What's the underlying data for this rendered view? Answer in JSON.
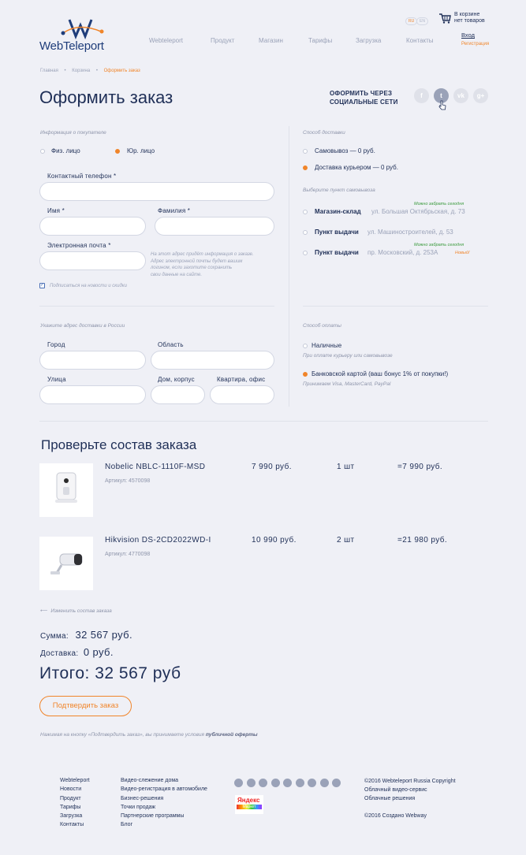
{
  "header": {
    "logo": "WebTeleport",
    "nav": [
      "Webteleport",
      "Продукт",
      "Магазин",
      "Тарифы",
      "Загрузка",
      "Контакты"
    ],
    "lang": [
      "RU",
      "EN"
    ],
    "cart_line1": "В корзине",
    "cart_line2": "нет товаров",
    "login": "Вход",
    "register": "Регистрация"
  },
  "breadcrumb": [
    "Главная",
    "Корзина",
    "Оформить заказ"
  ],
  "page_title": "Оформить заказ",
  "social": {
    "label_line1": "ОФОРМИТЬ ЧЕРЕЗ",
    "label_line2": "СОЦИАЛЬНЫЕ СЕТИ",
    "icons": [
      "f",
      "t",
      "vk",
      "g+"
    ]
  },
  "buyer": {
    "section": "Информация о покупателе",
    "type_individual": "Физ. лицо",
    "type_legal": "Юр. лицо",
    "phone_label": "Контактный телефон *",
    "name_label": "Имя *",
    "surname_label": "Фамилия *",
    "email_label": "Электронная почта *",
    "email_hint": [
      "На этот адрес придёт информация о заказе.",
      "Адрес электронной почты будет вашим",
      "логином, если захотите сохранить",
      "свои данные на сайте."
    ],
    "subscribe": "Подписаться на новости и скидки"
  },
  "address": {
    "section": "Укажите адрес доставки в России",
    "city": "Город",
    "region": "Область",
    "street": "Улица",
    "house": "Дом, корпус",
    "apt": "Квартира, офис"
  },
  "delivery": {
    "section": "Способ доставки",
    "pickup": "Самовывоз — 0 руб.",
    "courier": "Доставка курьером — 0 руб.",
    "pickup_section": "Выберите пункт самовывоза",
    "points": [
      {
        "name": "Магазин-склад",
        "addr": "ул. Большая Октябрьская, д. 73",
        "tag": "Можно забрать сегодня"
      },
      {
        "name": "Пункт выдачи",
        "addr": "ул. Машиностроителей, д. 53",
        "tag": ""
      },
      {
        "name": "Пункт выдачи",
        "addr": "пр. Московский, д. 253А",
        "tag": "Можно забрать сегодня",
        "badge": "Новый!"
      }
    ]
  },
  "payment": {
    "section": "Способ оплаты",
    "cash": "Наличные",
    "cash_hint": "При оплате курьеру или самовывозе",
    "card": "Банковской картой (ваш бонус 1% от покупки!)",
    "card_hint": "Принимаем Visa, MasterCard, PayPal"
  },
  "order": {
    "title": "Проверьте состав заказа",
    "items": [
      {
        "name": "Nobelic NBLC-1110F-MSD",
        "sku": "Артикул: 4570098",
        "price": "7 990 руб.",
        "qty": "1 шт",
        "total": "=7 990 руб."
      },
      {
        "name": "Hikvision DS-2CD2022WD-I",
        "sku": "Артикул: 4770098",
        "price": "10 990 руб.",
        "qty": "2 шт",
        "total": "=21 980 руб."
      }
    ],
    "back_link": "Изменить состав заказа",
    "sum_label": "Сумма:",
    "sum_value": "32 567 руб.",
    "delivery_label": "Доставка:",
    "delivery_value": "0 руб.",
    "total": "Итого: 32 567 руб",
    "confirm_button": "Подтвердить заказ",
    "terms_prefix": "Нажимая на кнопку «Подтвердить заказ», вы принимаете условия ",
    "terms_link": "публичной оферты"
  },
  "footer": {
    "col1": [
      "Webteleport",
      "Новости",
      "Продукт",
      "Тарифы",
      "Загрузка",
      "Контакты"
    ],
    "col2": [
      "Видео-слежение дома",
      "Видео-регистрация в автомобиле",
      "Бизнес-решения",
      "Точки продаж",
      "Партнерские программы",
      "Блог"
    ],
    "yandex_line1": "Яндекс",
    "yandex_line2": "Маркет",
    "copy1": "©2016 Webteleport Russia Copyright",
    "copy2": "Облачный видео-сервис",
    "copy3": "Облачные решения",
    "copy4": "©2016  Создано Webway"
  }
}
